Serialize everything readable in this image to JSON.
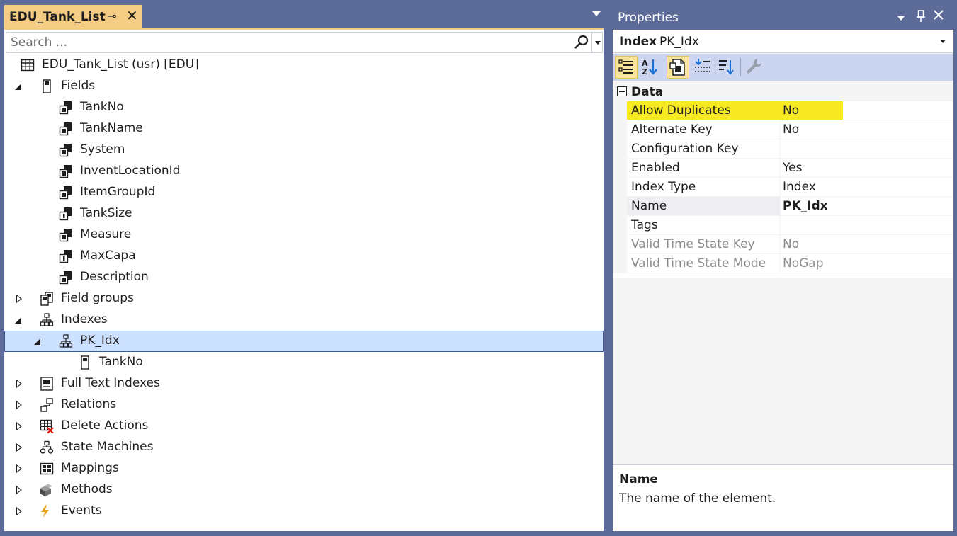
{
  "document_tab": {
    "title": "EDU_Tank_List",
    "pin_icon": "pin-icon",
    "close_glyph": "✕"
  },
  "search": {
    "placeholder": "Search ..."
  },
  "tree": {
    "root": "EDU_Tank_List (usr) [EDU]",
    "fields_label": "Fields",
    "fields": [
      "TankNo",
      "TankName",
      "System",
      "InventLocationId",
      "ItemGroupId",
      "TankSize",
      "Measure",
      "MaxCapa",
      "Description"
    ],
    "field_groups": "Field groups",
    "indexes": "Indexes",
    "index_name": "PK_Idx",
    "index_field": "TankNo",
    "full_text_indexes": "Full Text Indexes",
    "relations": "Relations",
    "delete_actions": "Delete Actions",
    "state_machines": "State Machines",
    "mappings": "Mappings",
    "methods": "Methods",
    "events": "Events"
  },
  "properties": {
    "title": "Properties",
    "object_type": "Index",
    "object_name": "PK_Idx",
    "category": "Data",
    "rows": [
      {
        "name": "Allow Duplicates",
        "value": "No"
      },
      {
        "name": "Alternate Key",
        "value": "No"
      },
      {
        "name": "Configuration Key",
        "value": ""
      },
      {
        "name": "Enabled",
        "value": "Yes"
      },
      {
        "name": "Index Type",
        "value": "Index"
      },
      {
        "name": "Name",
        "value": "PK_Idx"
      },
      {
        "name": "Tags",
        "value": ""
      },
      {
        "name": "Valid Time State Key",
        "value": "No"
      },
      {
        "name": "Valid Time State Mode",
        "value": "NoGap"
      }
    ],
    "description_title": "Name",
    "description_text": "The name of the element."
  },
  "colors": {
    "chrome": "#5d6b99",
    "active_tab": "#f5cc84",
    "selection": "#cce0ff",
    "highlight": "#f7ea23",
    "toolbar": "#ccd5f0"
  }
}
